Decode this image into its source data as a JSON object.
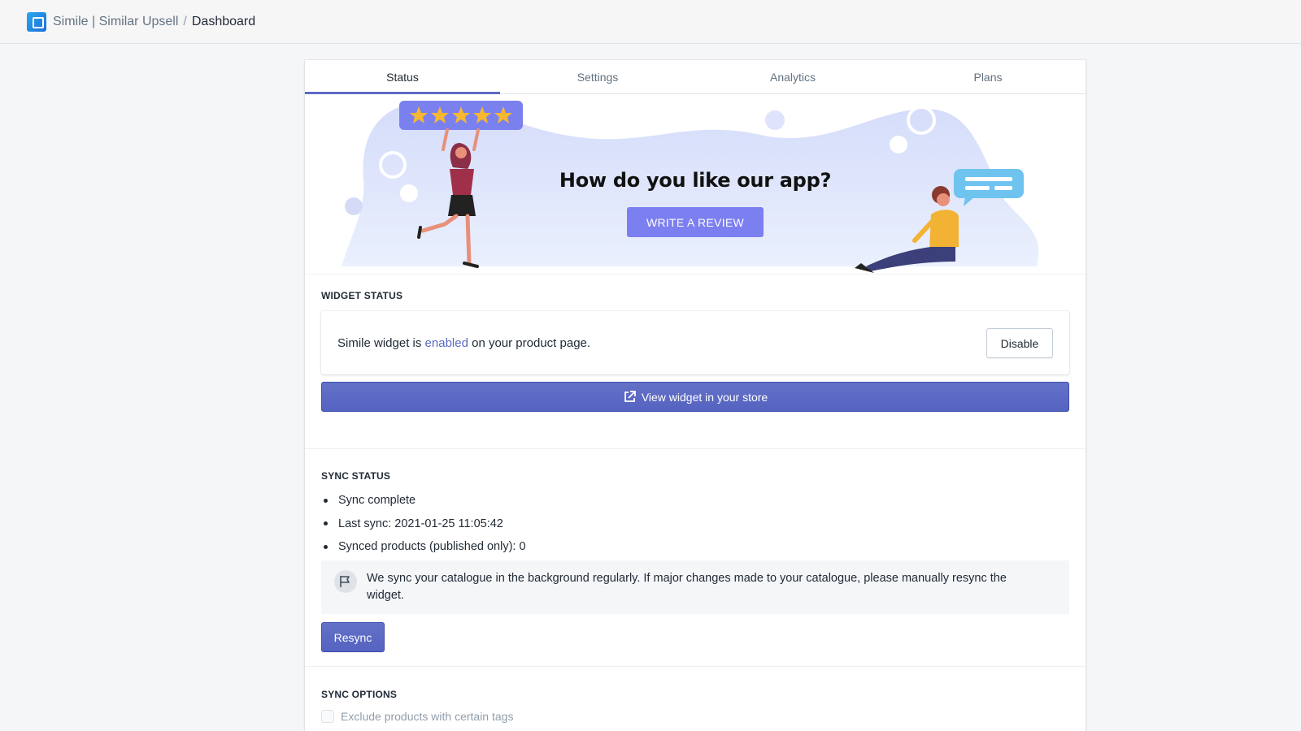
{
  "header": {
    "app_name": "Simile | Similar Upsell",
    "separator": "/",
    "page": "Dashboard"
  },
  "tabs": [
    {
      "label": "Status",
      "active": true
    },
    {
      "label": "Settings",
      "active": false
    },
    {
      "label": "Analytics",
      "active": false
    },
    {
      "label": "Plans",
      "active": false
    }
  ],
  "banner": {
    "title": "How do you like our app?",
    "button_label": "WRITE A REVIEW",
    "rating_stars": 5
  },
  "widget_status": {
    "title": "WIDGET STATUS",
    "text_before": "Simile widget is ",
    "state": "enabled",
    "text_after": " on your product page.",
    "disable_label": "Disable",
    "view_label": "View widget in your store"
  },
  "sync_status": {
    "title": "SYNC STATUS",
    "items": [
      "Sync complete",
      "Last sync: 2021-01-25 11:05:42",
      "Synced products (published only): 0"
    ],
    "callout": "We sync your catalogue in the background regularly. If major changes made to your catalogue, please manually resync the widget.",
    "resync_label": "Resync"
  },
  "sync_options": {
    "title": "SYNC OPTIONS",
    "exclude_label": "Exclude products with certain tags",
    "exclude_checked": false
  },
  "colors": {
    "accent": "#5c6ac4",
    "review_button": "#7c7ff0"
  }
}
